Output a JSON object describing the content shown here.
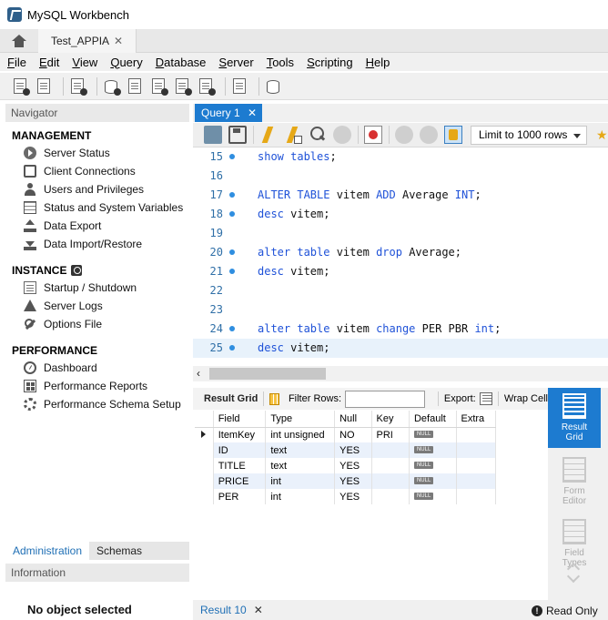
{
  "window": {
    "title": "MySQL Workbench"
  },
  "tabs": {
    "connection_tab": "Test_APPIA",
    "close_glyph": "✕"
  },
  "menu": [
    {
      "first": "F",
      "rest": "ile"
    },
    {
      "first": "E",
      "rest": "dit"
    },
    {
      "first": "V",
      "rest": "iew"
    },
    {
      "first": "Q",
      "rest": "uery"
    },
    {
      "first": "D",
      "rest": "atabase"
    },
    {
      "first": "S",
      "rest": "erver"
    },
    {
      "first": "T",
      "rest": "ools"
    },
    {
      "first": "S",
      "rest": "cripting"
    },
    {
      "first": "H",
      "rest": "elp"
    }
  ],
  "navigator": {
    "header": "Navigator",
    "management": {
      "title": "MANAGEMENT",
      "items": [
        "Server Status",
        "Client Connections",
        "Users and Privileges",
        "Status and System Variables",
        "Data Export",
        "Data Import/Restore"
      ]
    },
    "instance": {
      "title": "INSTANCE",
      "items": [
        "Startup / Shutdown",
        "Server Logs",
        "Options File"
      ]
    },
    "performance": {
      "title": "PERFORMANCE",
      "items": [
        "Dashboard",
        "Performance Reports",
        "Performance Schema Setup"
      ]
    },
    "tabs": {
      "administration": "Administration",
      "schemas": "Schemas"
    },
    "information": {
      "header": "Information",
      "no_object": "No object selected"
    }
  },
  "query": {
    "tab_label": "Query 1",
    "close_glyph": "✕",
    "limit": "Limit to 1000 rows",
    "lines": [
      {
        "num": "15",
        "dot": true,
        "parts": [
          [
            "kw",
            "show tables"
          ],
          [
            "tx",
            ";"
          ]
        ]
      },
      {
        "num": "16",
        "dot": false,
        "parts": []
      },
      {
        "num": "17",
        "dot": true,
        "parts": [
          [
            "kw",
            "ALTER TABLE"
          ],
          [
            "tx",
            " vitem "
          ],
          [
            "kw",
            "ADD"
          ],
          [
            "tx",
            " Average "
          ],
          [
            "kw",
            "INT"
          ],
          [
            "tx",
            ";"
          ]
        ]
      },
      {
        "num": "18",
        "dot": true,
        "parts": [
          [
            "kw",
            "desc"
          ],
          [
            "tx",
            " vitem;"
          ]
        ]
      },
      {
        "num": "19",
        "dot": false,
        "parts": []
      },
      {
        "num": "20",
        "dot": true,
        "parts": [
          [
            "kw",
            "alter table"
          ],
          [
            "tx",
            " vitem "
          ],
          [
            "kw",
            "drop"
          ],
          [
            "tx",
            " Average;"
          ]
        ]
      },
      {
        "num": "21",
        "dot": true,
        "parts": [
          [
            "kw",
            "desc"
          ],
          [
            "tx",
            " vitem;"
          ]
        ]
      },
      {
        "num": "22",
        "dot": false,
        "parts": []
      },
      {
        "num": "23",
        "dot": false,
        "parts": []
      },
      {
        "num": "24",
        "dot": true,
        "parts": [
          [
            "kw",
            "alter table"
          ],
          [
            "tx",
            " vitem "
          ],
          [
            "kw",
            "change"
          ],
          [
            "tx",
            " PER PBR "
          ],
          [
            "kw",
            "int"
          ],
          [
            "tx",
            ";"
          ]
        ]
      },
      {
        "num": "25",
        "dot": true,
        "parts": [
          [
            "kw",
            "desc"
          ],
          [
            "tx",
            " vitem;"
          ]
        ],
        "current": true
      }
    ]
  },
  "result": {
    "toolbar": {
      "result_grid": "Result Grid",
      "filter_rows": "Filter Rows:",
      "export": "Export:",
      "wrap_cell": "Wrap Cell"
    },
    "columns": [
      "Field",
      "Type",
      "Null",
      "Key",
      "Default",
      "Extra"
    ],
    "rows": [
      [
        "ItemKey",
        "int unsigned",
        "NO",
        "PRI",
        "NULL",
        ""
      ],
      [
        "ID",
        "text",
        "YES",
        "",
        "NULL",
        ""
      ],
      [
        "TITLE",
        "text",
        "YES",
        "",
        "NULL",
        ""
      ],
      [
        "PRICE",
        "int",
        "YES",
        "",
        "NULL",
        ""
      ],
      [
        "PER",
        "int",
        "YES",
        "",
        "NULL",
        ""
      ]
    ],
    "side_panel": {
      "result_grid": "Result Grid",
      "form_editor": "Form Editor",
      "field_types": "Field Types"
    },
    "bottom_tab": "Result 10",
    "read_only": "Read Only"
  },
  "colors": {
    "accent": "#1d7bd0",
    "keyword": "#1f52d8",
    "line_number": "#2f6fa7"
  }
}
